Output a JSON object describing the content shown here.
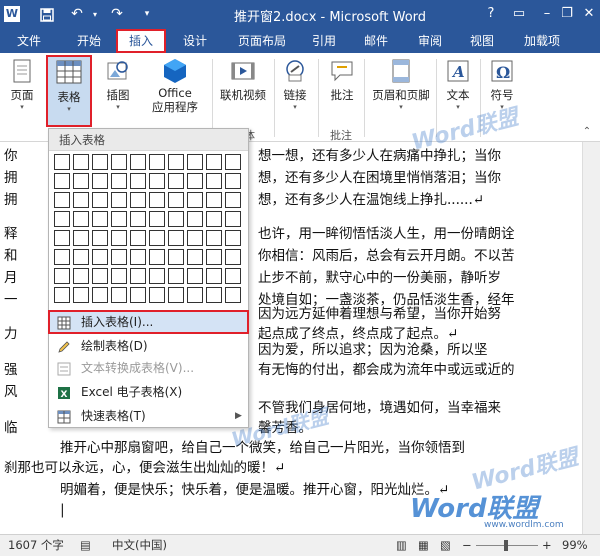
{
  "titlebar": {
    "app_icon": "W",
    "save_icon": "save-icon",
    "title": "推开窗2.docx - Microsoft Word",
    "help": "?",
    "minimize": "–",
    "restore": "❐",
    "close": "✕"
  },
  "tabs": [
    {
      "label": "文件"
    },
    {
      "label": "开始"
    },
    {
      "label": "插入"
    },
    {
      "label": "设计"
    },
    {
      "label": "页面布局"
    },
    {
      "label": "引用"
    },
    {
      "label": "邮件"
    },
    {
      "label": "审阅"
    },
    {
      "label": "视图"
    },
    {
      "label": "加载项"
    }
  ],
  "ribbon": {
    "page": "页面",
    "table": "表格",
    "illustration": "插图",
    "office_line1": "Office",
    "office_line2": "应用程序",
    "online_video": "联机视频",
    "link": "链接",
    "comment": "批注",
    "header_footer": "页眉和页脚",
    "text": "文本",
    "symbol": "符号",
    "group_media_tail": "体",
    "group_comment": "批注"
  },
  "dropdown": {
    "header": "插入表格",
    "items": [
      {
        "label": "插入表格(I)...",
        "icon": "table-icon",
        "disabled": false
      },
      {
        "label": "绘制表格(D)",
        "icon": "pencil-icon",
        "disabled": false
      },
      {
        "label": "文本转换成表格(V)...",
        "icon": "convert-icon",
        "disabled": true
      },
      {
        "label": "Excel 电子表格(X)",
        "icon": "excel-icon",
        "disabled": false
      },
      {
        "label": "快速表格(T)",
        "icon": "quick-table-icon",
        "disabled": false
      }
    ]
  },
  "document": {
    "lines": [
      {
        "text": "你"
      },
      {
        "text": "拥"
      },
      {
        "text": "拥"
      },
      {
        "text": "释"
      },
      {
        "text": "和"
      },
      {
        "text": "月"
      },
      {
        "text": "一"
      },
      {
        "text": "力"
      },
      {
        "text": "强"
      },
      {
        "text": "风"
      },
      {
        "text": "临"
      }
    ],
    "right_lines": [
      {
        "text": "想一想，还有多少人在病痛中挣扎；当你"
      },
      {
        "text": "想，还有多少人在困境里悄悄落泪；当你"
      },
      {
        "text": "想，还有多少人在温饱线上挣扎......↵"
      },
      {
        "text": "也许，用一眸彻悟恬淡人生，用一份晴朗诠"
      },
      {
        "text": "你相信：风雨后，总会有云开月朗。不以苦"
      },
      {
        "text": "止步不前，默守心中的一份美丽，静听岁"
      },
      {
        "text": "处境自如；一盏淡茶，仍品恬淡生香，经年"
      },
      {
        "text": "因为远方延伸着理想与希望，当你开始努"
      },
      {
        "text": "起点成了终点，终点成了起点。↵"
      },
      {
        "text": "因为爱，所以追求；因为沧桑，所以坚"
      },
      {
        "text": "有无悔的付出，都会成为流年中或远或近的"
      },
      {
        "text": "不管我们身居何地，境遇如何，当幸福来"
      },
      {
        "text": "馨芳香。"
      }
    ],
    "full_lines": [
      {
        "text": "推开心中那扇窗吧，给自己一个微笑，给自己一片阳光，当你领悟到"
      },
      {
        "text": "刹那也可以永远，心，便会滋生出灿灿的暖！↵"
      },
      {
        "text": "明媚着，便是快乐；快乐着，便是温暖。推开心窗，阳光灿烂。↵"
      }
    ]
  },
  "status": {
    "word_count": "1607 个字",
    "language": "中文(中国)",
    "zoom": "99%"
  },
  "watermarks": {
    "brand": "Word联盟",
    "site": "www.wordlm.com"
  }
}
